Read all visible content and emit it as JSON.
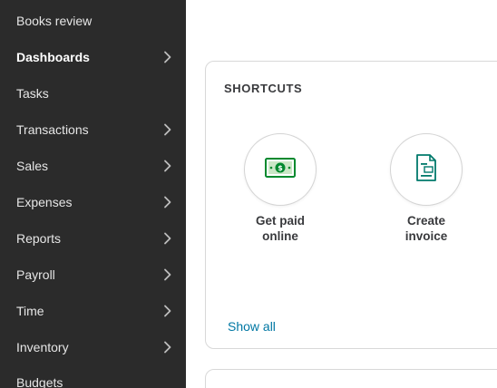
{
  "sidebar": {
    "items": [
      {
        "label": "Books review",
        "has_chevron": false,
        "bold": false
      },
      {
        "label": "Dashboards",
        "has_chevron": true,
        "bold": true
      },
      {
        "label": "Tasks",
        "has_chevron": false,
        "bold": false
      },
      {
        "label": "Transactions",
        "has_chevron": true,
        "bold": false
      },
      {
        "label": "Sales",
        "has_chevron": true,
        "bold": false
      },
      {
        "label": "Expenses",
        "has_chevron": true,
        "bold": false
      },
      {
        "label": "Reports",
        "has_chevron": true,
        "bold": false
      },
      {
        "label": "Payroll",
        "has_chevron": true,
        "bold": false
      },
      {
        "label": "Time",
        "has_chevron": true,
        "bold": false
      },
      {
        "label": "Inventory",
        "has_chevron": true,
        "bold": false
      },
      {
        "label": "Budgets",
        "has_chevron": false,
        "bold": false
      }
    ]
  },
  "shortcuts": {
    "title": "SHORTCUTS",
    "items": [
      {
        "label": "Get paid\nonline",
        "icon": "money-bill-icon"
      },
      {
        "label": "Create\ninvoice",
        "icon": "invoice-icon"
      }
    ],
    "show_all": "Show all"
  },
  "colors": {
    "sidebar_bg": "#2b2b2b",
    "link": "#0077a3",
    "icon_green": "#00892e"
  }
}
